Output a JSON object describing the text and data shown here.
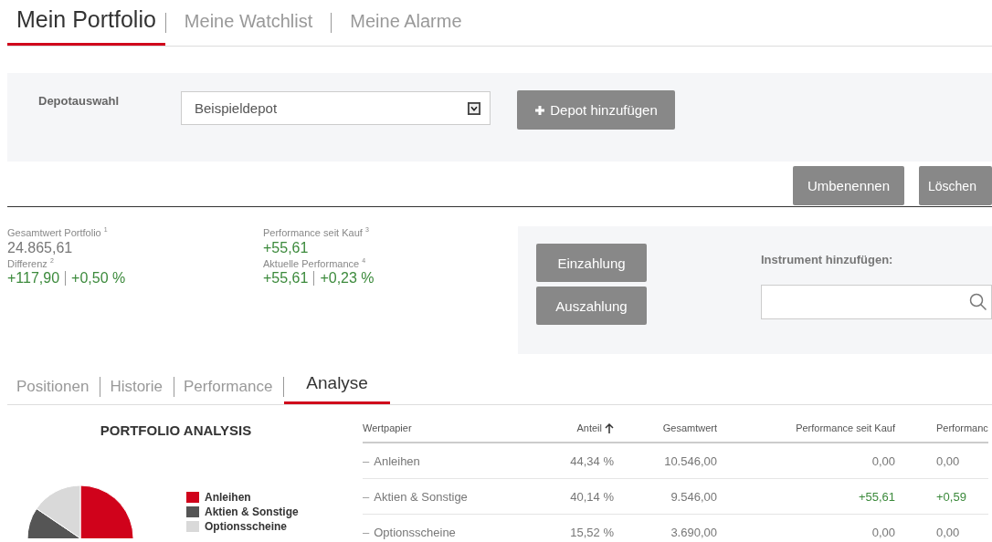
{
  "main_tabs": [
    {
      "label": "Mein Portfolio",
      "selected": true
    },
    {
      "label": "Meine Watchlist",
      "selected": false
    },
    {
      "label": "Meine Alarme",
      "selected": false
    }
  ],
  "depot": {
    "label": "Depotauswahl",
    "select_value": "Beispieldepot",
    "add_button": "Depot hinzufügen"
  },
  "depot_actions": [
    "Umbenennen",
    "Löschen"
  ],
  "summary": [
    {
      "label": "Gesamtwert Portfolio $^{1}$",
      "values": [
        {
          "text": "24.865,61",
          "positive": false
        }
      ],
      "sub_label": "Differenz $^{2}$",
      "sub_values": [
        {
          "text": "+117,90",
          "positive": true
        },
        {
          "text": "+0,50 %",
          "positive": true
        }
      ]
    },
    {
      "label": "Performance seit Kauf $^{3}$",
      "values": [
        {
          "text": "+55,61",
          "positive": true
        }
      ],
      "sub_label": "Aktuelle Performance $^{4}$",
      "sub_values": [
        {
          "text": "+55,61",
          "positive": true
        },
        {
          "text": "+0,23 %",
          "positive": true
        }
      ]
    }
  ],
  "cash_buttons": [
    "Einzahlung",
    "Auszahlung"
  ],
  "instrument": {
    "label": "Instrument hinzufügen:"
  },
  "sub_tabs": [
    {
      "label": "Positionen",
      "selected": false
    },
    {
      "label": "Historie",
      "selected": false
    },
    {
      "label": "Performance",
      "selected": false
    },
    {
      "label": "Analyse",
      "selected": true
    }
  ],
  "analysis": {
    "title": "PORTFOLIO ANALYSIS",
    "chart_data": {
      "type": "pie",
      "categories": [
        "Anleihen",
        "Aktien & Sonstige",
        "Optionsscheine"
      ],
      "values": [
        44.34,
        40.14,
        15.52
      ],
      "colors": [
        "#d0021b",
        "#555555",
        "#d9d9d9"
      ],
      "legend": "right"
    }
  },
  "table": {
    "columns": [
      {
        "label": "Wertpapier",
        "sorted": false
      },
      {
        "label": "Anteil",
        "sorted": true
      },
      {
        "label": "Gesamtwert",
        "sorted": false
      },
      {
        "label": "Performance seit Kauf",
        "sorted": false
      },
      {
        "label": "Performanc",
        "sorted": false
      }
    ],
    "rows": [
      {
        "marker": "–",
        "cells": [
          {
            "text": "Anleihen",
            "positive": false
          },
          {
            "text": "44,34 %",
            "positive": false
          },
          {
            "text": "10.546,00",
            "positive": false
          },
          {
            "text": "0,00",
            "positive": false
          },
          {
            "text": "0,00",
            "positive": false
          }
        ]
      },
      {
        "marker": "–",
        "cells": [
          {
            "text": "Aktien & Sonstige",
            "positive": false
          },
          {
            "text": "40,14 %",
            "positive": false
          },
          {
            "text": "9.546,00",
            "positive": false
          },
          {
            "text": "+55,61",
            "positive": true
          },
          {
            "text": "+0,59",
            "positive": true
          }
        ]
      },
      {
        "marker": "–",
        "cells": [
          {
            "text": "Optionsscheine",
            "positive": false
          },
          {
            "text": "15,52 %",
            "positive": false
          },
          {
            "text": "3.690,00",
            "positive": false
          },
          {
            "text": "0,00",
            "positive": false
          },
          {
            "text": "0,00",
            "positive": false
          }
        ]
      }
    ]
  }
}
